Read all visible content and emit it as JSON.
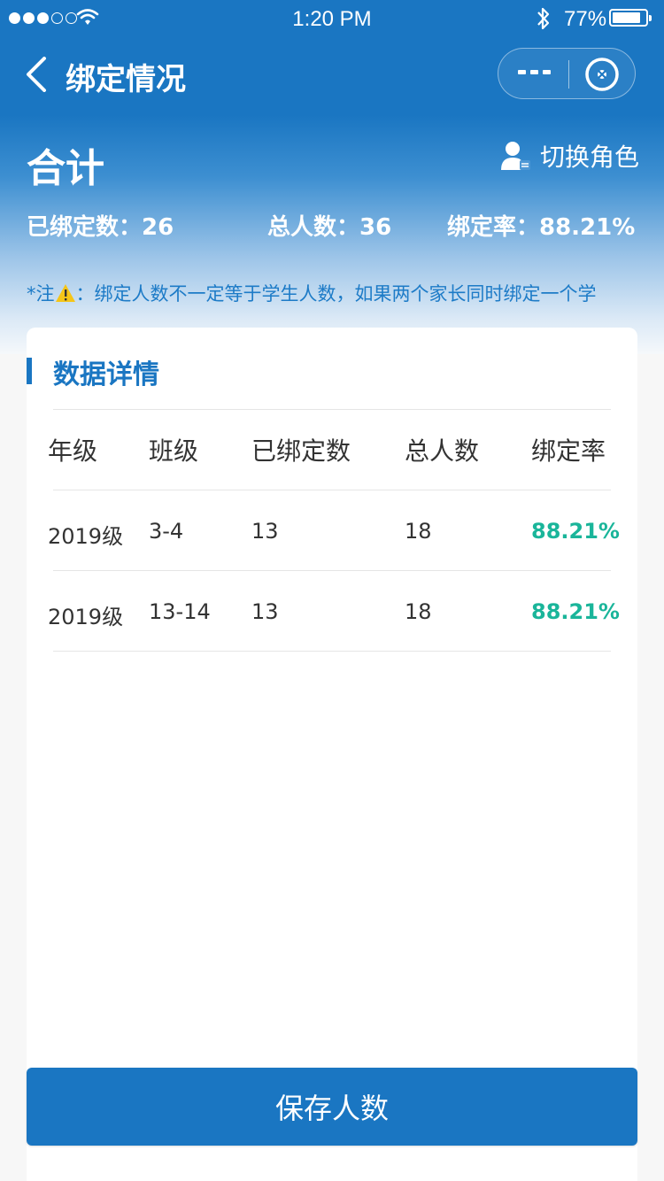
{
  "status_bar": {
    "time": "1:20 PM",
    "battery": "77%"
  },
  "nav": {
    "title": "绑定情况"
  },
  "summary": {
    "title": "合计",
    "switch_role": "切换角色",
    "bound": "已绑定数：26",
    "total": "总人数：36",
    "rate": "绑定率：88.21%",
    "note_prefix": "*注",
    "note_text": "：绑定人数不一定等于学生人数，如果两个家长同时绑定一个学"
  },
  "detail": {
    "title": "数据详情",
    "headers": [
      "年级",
      "班级",
      "已绑定数",
      "总人数",
      "绑定率"
    ],
    "rows": [
      [
        "2019级",
        "3-4",
        "13",
        "18",
        "88.21%"
      ],
      [
        "2019级",
        "13-14",
        "13",
        "18",
        "88.21%"
      ]
    ]
  },
  "save_label": "保存人数",
  "colors": {
    "primary": "#1a76c2",
    "rate_green": "#1ab59a"
  },
  "icons": [
    "signal-dots-icon",
    "wifi-icon",
    "bluetooth-icon",
    "battery-icon",
    "back-arrow-icon",
    "more-dots-icon",
    "close-circle-icon",
    "user-switch-icon",
    "warning-icon"
  ]
}
